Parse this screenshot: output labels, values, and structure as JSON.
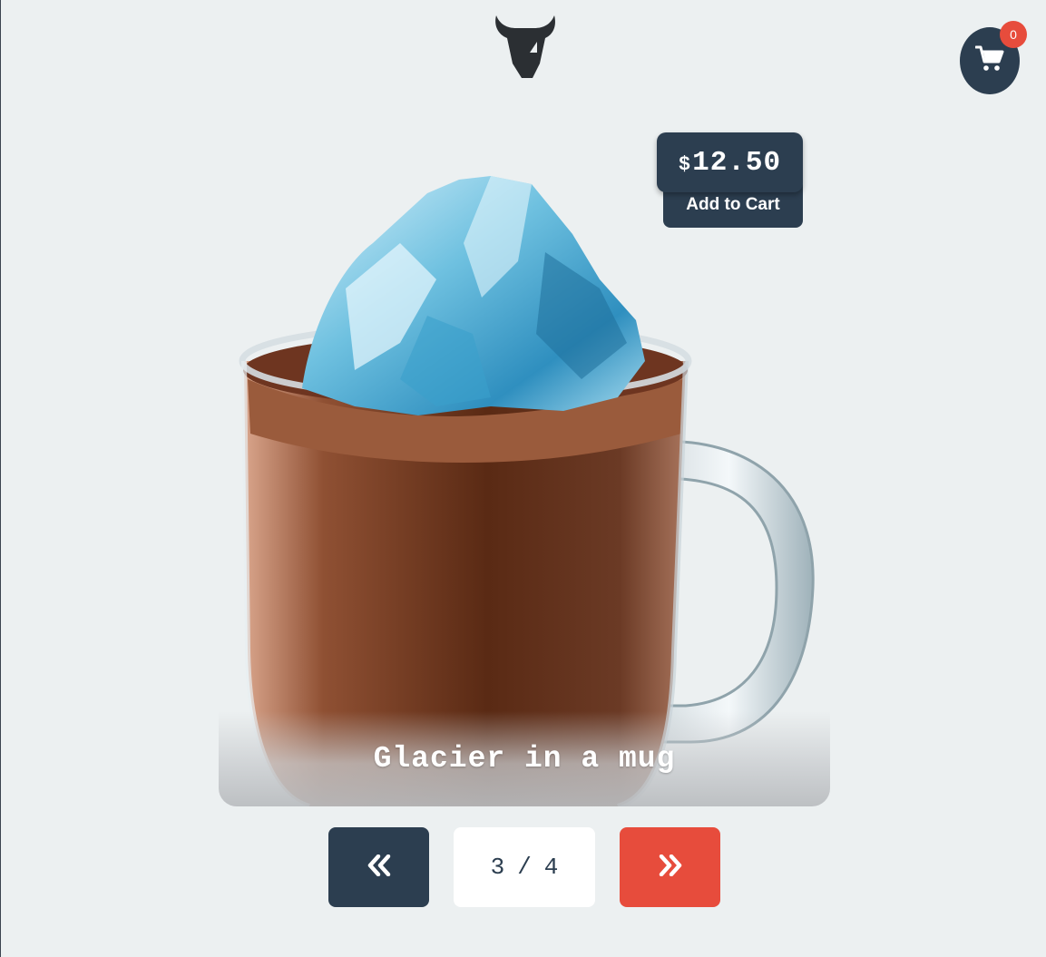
{
  "header": {
    "logo_icon": "bull-head-icon",
    "cart_icon": "shopping-cart-icon",
    "cart_count": "0"
  },
  "product": {
    "title": "Glacier in a mug",
    "currency_symbol": "$",
    "price": "12.50",
    "add_to_cart_label": "Add to Cart",
    "image_icon": "hot-chocolate-mug-with-iceberg"
  },
  "pagination": {
    "current": "3",
    "separator": "/",
    "total": "4",
    "prev_icon": "double-chevron-left-icon",
    "next_icon": "double-chevron-right-icon"
  },
  "colors": {
    "background": "#ecf0f1",
    "primary": "#2c3e50",
    "accent": "#e74c3c",
    "surface": "#ffffff"
  }
}
